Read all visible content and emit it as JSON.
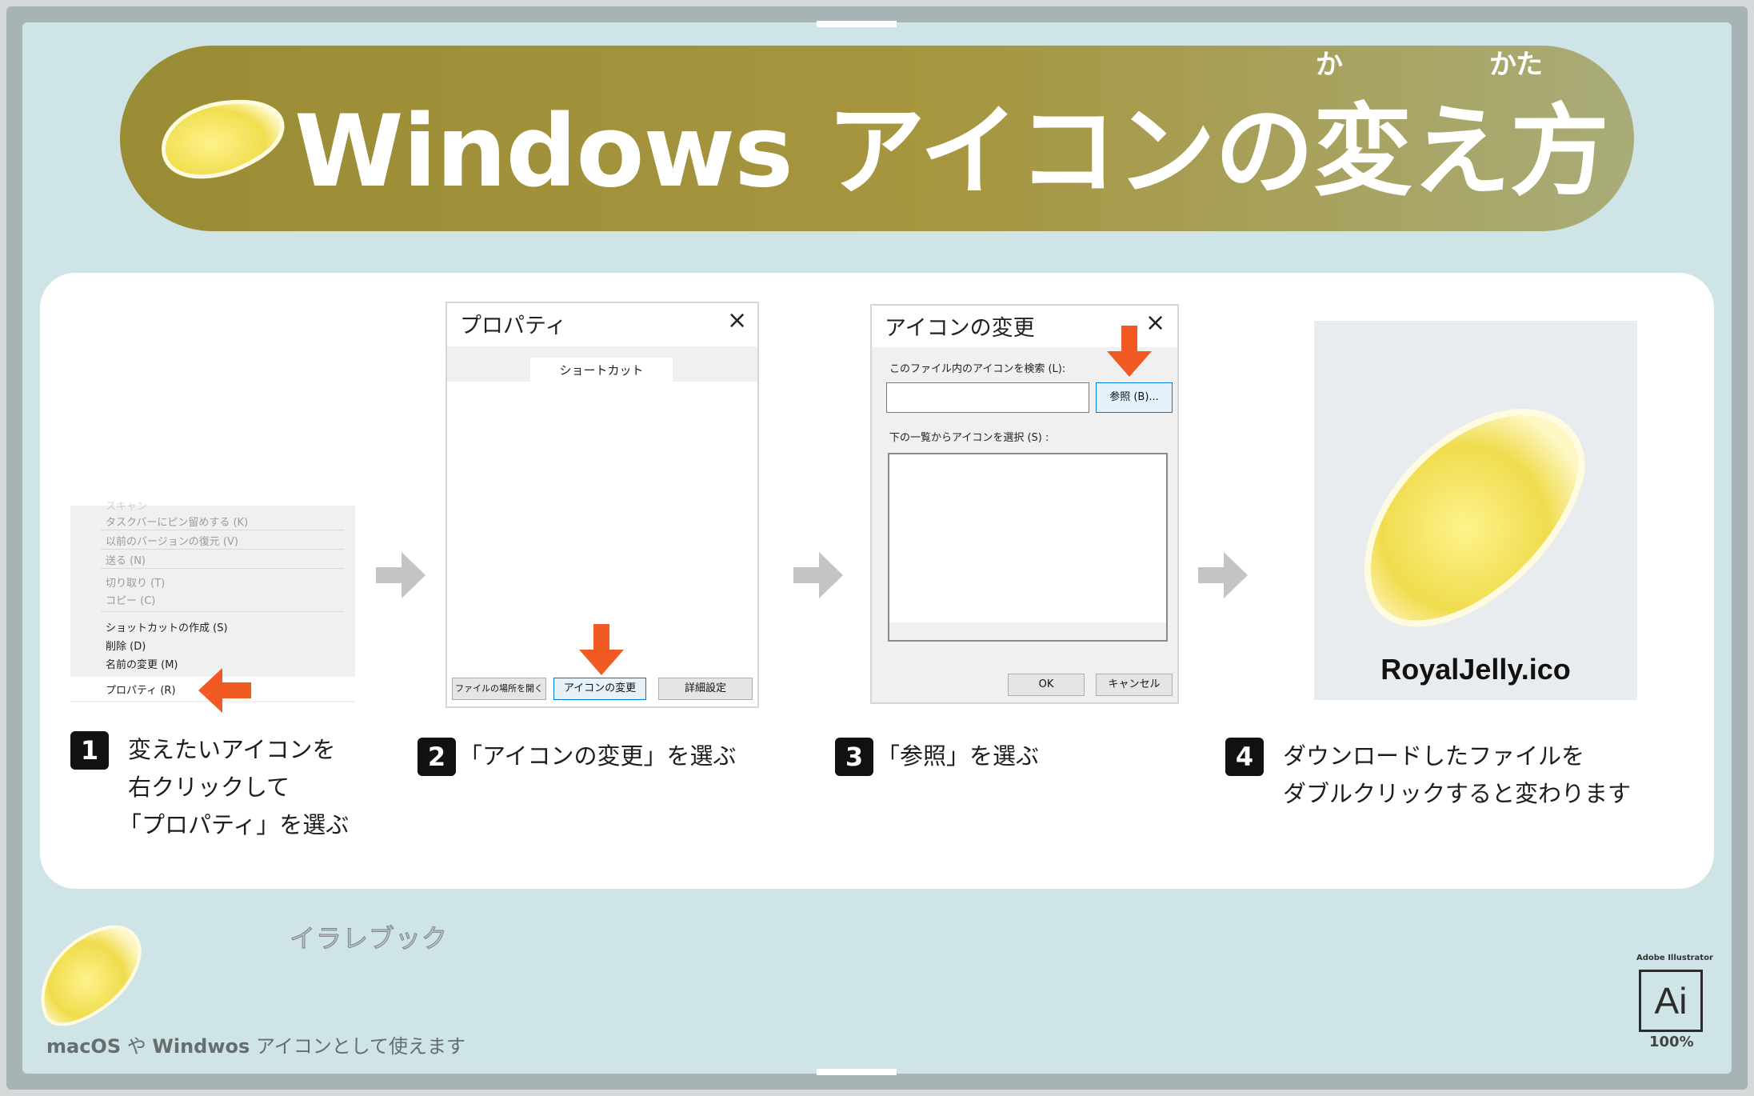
{
  "header": {
    "title": "Windows アイコンの変え方",
    "ruby_ka": "か",
    "ruby_kata": "かた"
  },
  "steps": [
    {
      "num": "1",
      "lines": [
        "変えたいアイコンを",
        "右クリックして",
        "「プロパティ」を選ぶ"
      ]
    },
    {
      "num": "2",
      "lines": [
        "「アイコンの変更」を選ぶ"
      ]
    },
    {
      "num": "3",
      "lines": [
        "「参照」を選ぶ"
      ]
    },
    {
      "num": "4",
      "lines": [
        "ダウンロードしたファイルを",
        "ダブルクリックすると変わります"
      ]
    }
  ],
  "context_menu": {
    "items_dim": [
      "スキャン",
      "タスクバーにピン留めする (K)",
      "以前のバージョンの復元 (V)",
      "送る (N)",
      "切り取り (T)",
      "コピー (C)"
    ],
    "items": [
      "ショットカットの作成 (S)",
      "削除 (D)",
      "名前の変更 (M)"
    ],
    "selected": "プロパティ (R)"
  },
  "properties_dialog": {
    "title": "プロパティ",
    "tab": "ショートカット",
    "buttons": [
      "ファイルの場所を開く",
      "アイコンの変更",
      "詳細設定"
    ]
  },
  "change_icon_dialog": {
    "title": "アイコンの変更",
    "search_label": "このファイル内のアイコンを検索 (L):",
    "browse_button": "参照 (B)...",
    "list_label": "下の一覧からアイコンを選択 (S) :",
    "ok": "OK",
    "cancel": "キャンセル"
  },
  "result": {
    "filename": "RoyalJelly.ico"
  },
  "footer": {
    "brand": "イラレブック",
    "note_a": "macOS",
    "note_b": " や ",
    "note_c": "Windwos",
    "note_d": " アイコンとして使えます",
    "ai_label": "Adobe Illustrator",
    "ai_icon": "Ai",
    "ai_zoom": "100%"
  },
  "colors": {
    "banner": "#a6963f",
    "background": "#cee4e6",
    "accent_orange": "#f15a22",
    "arrow_gray": "#c4c4c4",
    "jelly": "#f5e568"
  },
  "icons": [
    "royal-jelly-icon",
    "close-icon",
    "arrow-right-icon",
    "arrow-down-icon",
    "arrow-left-icon",
    "adobe-illustrator-icon"
  ]
}
